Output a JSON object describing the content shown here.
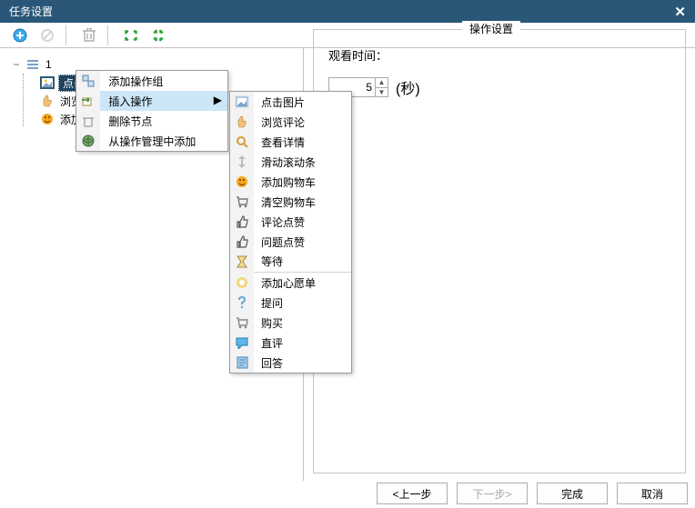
{
  "window": {
    "title": "任务设置",
    "close": "✕"
  },
  "tree": {
    "root": {
      "label": "1"
    },
    "children": [
      {
        "label": "点击图片",
        "selected": true
      },
      {
        "label": "浏览"
      },
      {
        "label": "添加"
      }
    ]
  },
  "context_menu": {
    "items": [
      {
        "label": "添加操作组"
      },
      {
        "label": "插入操作",
        "highlight": true,
        "submenu": true
      },
      {
        "label": "删除节点"
      },
      {
        "label": "从操作管理中添加"
      }
    ]
  },
  "submenu": {
    "groups": [
      [
        "点击图片",
        "浏览评论",
        "查看详情",
        "滑动滚动条",
        "添加购物车",
        "清空购物车",
        "评论点赞",
        "问题点赞",
        "等待"
      ],
      [
        "添加心愿单",
        "提问",
        "购买",
        "直评",
        "回答"
      ]
    ]
  },
  "right_panel": {
    "title": "操作设置",
    "view_time_label": "观看时间：",
    "view_time_value": "5",
    "unit": "(秒)"
  },
  "buttons": {
    "prev": "<上一步",
    "next": "下一步>",
    "finish": "完成",
    "cancel": "取消"
  },
  "colors": {
    "titlebar": "#2a5778",
    "selection": "#1f445c",
    "menu_hover": "#cde6f7"
  }
}
